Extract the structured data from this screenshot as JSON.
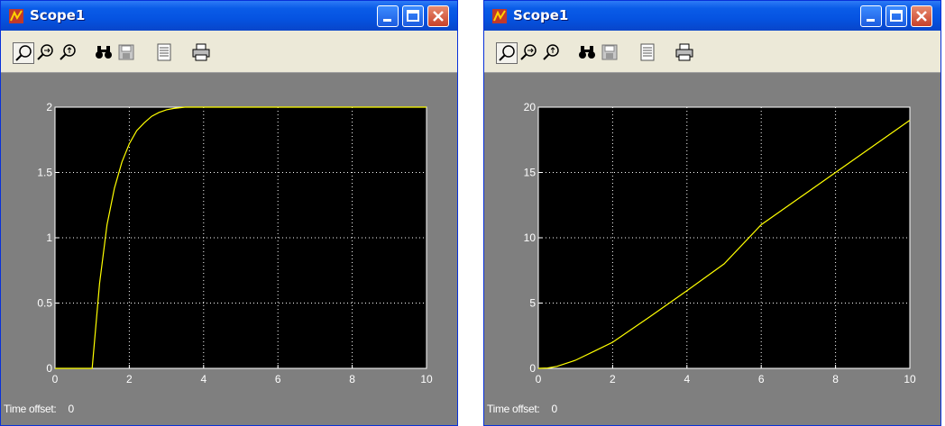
{
  "windows": [
    {
      "title": "Scope1",
      "time_offset_label": "Time offset:",
      "time_offset_value": "0"
    },
    {
      "title": "Scope1",
      "time_offset_label": "Time offset:",
      "time_offset_value": "0"
    }
  ],
  "toolbar_icons": [
    "zoom-icon",
    "zoom-x-icon",
    "zoom-y-icon",
    "autoscale-binoculars-icon",
    "save-axes-icon",
    "scope-parameters-icon",
    "print-icon"
  ],
  "colors": {
    "trace": "#ffff00",
    "axes_bg": "#000000",
    "figure_bg": "#7f7f7f",
    "grid": "#ffffff"
  },
  "chart_data": [
    {
      "type": "line",
      "xlim": [
        0,
        10
      ],
      "ylim": [
        0,
        2
      ],
      "xticks": [
        "0",
        "2",
        "4",
        "6",
        "8",
        "10"
      ],
      "yticks": [
        "0",
        "0.5",
        "1",
        "1.5",
        "2"
      ],
      "grid": true,
      "series": [
        {
          "x": [
            0,
            1.0,
            1.2,
            1.4,
            1.6,
            1.8,
            2.0,
            2.2,
            2.4,
            2.6,
            2.8,
            3.0,
            3.2,
            3.5,
            4.0,
            10
          ],
          "y": [
            0,
            0,
            0.65,
            1.1,
            1.38,
            1.58,
            1.72,
            1.82,
            1.88,
            1.93,
            1.96,
            1.98,
            1.99,
            2.0,
            2.0,
            2.0
          ]
        }
      ]
    },
    {
      "type": "line",
      "xlim": [
        0,
        10
      ],
      "ylim": [
        0,
        20
      ],
      "xticks": [
        "0",
        "2",
        "4",
        "6",
        "8",
        "10"
      ],
      "yticks": [
        "0",
        "5",
        "10",
        "15",
        "20"
      ],
      "grid": true,
      "series": [
        {
          "x": [
            0,
            0.25,
            0.5,
            1.0,
            1.5,
            2.0,
            3.0,
            4.0,
            5.0,
            6.0,
            7.0,
            8.0,
            9.0,
            10.0
          ],
          "y": [
            0,
            0.03,
            0.15,
            0.62,
            1.3,
            2.0,
            3.95,
            5.95,
            8.0,
            11.0,
            13.0,
            15.0,
            17.0,
            19.0
          ]
        }
      ]
    }
  ]
}
